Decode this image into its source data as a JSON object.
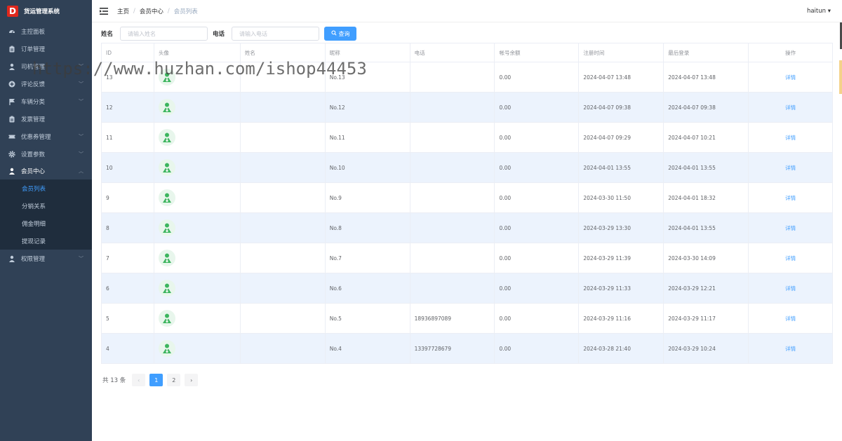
{
  "brand": {
    "logo_letter": "D",
    "title": "货运管理系统"
  },
  "sidebar": {
    "items": [
      {
        "label": "主控面板",
        "icon": "dashboard-icon",
        "arrow": false
      },
      {
        "label": "订单管理",
        "icon": "clipboard-icon",
        "arrow": false
      },
      {
        "label": "司机管理",
        "icon": "user-icon",
        "arrow": true
      },
      {
        "label": "评论反馈",
        "icon": "plus-circle-icon",
        "arrow": true
      },
      {
        "label": "车辆分类",
        "icon": "flag-icon",
        "arrow": true
      },
      {
        "label": "发票管理",
        "icon": "clipboard-icon",
        "arrow": false
      },
      {
        "label": "优惠券管理",
        "icon": "ticket-icon",
        "arrow": true
      },
      {
        "label": "设置参数",
        "icon": "gear-icon",
        "arrow": true
      },
      {
        "label": "会员中心",
        "icon": "user-icon",
        "arrow": true,
        "open": true
      },
      {
        "label": "权限管理",
        "icon": "user-icon",
        "arrow": true
      }
    ],
    "submenu": [
      {
        "label": "会员列表",
        "active": true
      },
      {
        "label": "分销关系",
        "active": false
      },
      {
        "label": "佣金明细",
        "active": false
      },
      {
        "label": "提现记录",
        "active": false
      }
    ]
  },
  "header": {
    "breadcrumb": [
      "主页",
      "会员中心",
      "会员列表"
    ],
    "user": "haitun"
  },
  "filter": {
    "name_label": "姓名",
    "name_placeholder": "请输入姓名",
    "phone_label": "电话",
    "phone_placeholder": "请输入电话",
    "search_label": "查询"
  },
  "table": {
    "columns": [
      "ID",
      "头像",
      "姓名",
      "昵称",
      "电话",
      "帐号余额",
      "注册时间",
      "最后登录",
      "操作"
    ],
    "rows": [
      {
        "id": "13",
        "name": "",
        "nickname": "No.13",
        "phone": "",
        "balance": "0.00",
        "registered": "2024-04-07 13:48",
        "last_login": "2024-04-07 13:48",
        "action": "详情"
      },
      {
        "id": "12",
        "name": "",
        "nickname": "No.12",
        "phone": "",
        "balance": "0.00",
        "registered": "2024-04-07 09:38",
        "last_login": "2024-04-07 09:38",
        "action": "详情"
      },
      {
        "id": "11",
        "name": "",
        "nickname": "No.11",
        "phone": "",
        "balance": "0.00",
        "registered": "2024-04-07 09:29",
        "last_login": "2024-04-07 10:21",
        "action": "详情"
      },
      {
        "id": "10",
        "name": "",
        "nickname": "No.10",
        "phone": "",
        "balance": "0.00",
        "registered": "2024-04-01 13:55",
        "last_login": "2024-04-01 13:55",
        "action": "详情"
      },
      {
        "id": "9",
        "name": "",
        "nickname": "No.9",
        "phone": "",
        "balance": "0.00",
        "registered": "2024-03-30 11:50",
        "last_login": "2024-04-01 18:32",
        "action": "详情"
      },
      {
        "id": "8",
        "name": "",
        "nickname": "No.8",
        "phone": "",
        "balance": "0.00",
        "registered": "2024-03-29 13:30",
        "last_login": "2024-04-01 13:55",
        "action": "详情"
      },
      {
        "id": "7",
        "name": "",
        "nickname": "No.7",
        "phone": "",
        "balance": "0.00",
        "registered": "2024-03-29 11:39",
        "last_login": "2024-03-30 14:09",
        "action": "详情"
      },
      {
        "id": "6",
        "name": "",
        "nickname": "No.6",
        "phone": "",
        "balance": "0.00",
        "registered": "2024-03-29 11:33",
        "last_login": "2024-03-29 12:21",
        "action": "详情"
      },
      {
        "id": "5",
        "name": "",
        "nickname": "No.5",
        "phone": "18936897089",
        "balance": "0.00",
        "registered": "2024-03-29 11:16",
        "last_login": "2024-03-29 11:17",
        "action": "详情"
      },
      {
        "id": "4",
        "name": "",
        "nickname": "No.4",
        "phone": "13397728679",
        "balance": "0.00",
        "registered": "2024-03-28 21:40",
        "last_login": "2024-03-29 10:24",
        "action": "详情"
      }
    ]
  },
  "pagination": {
    "total_text": "共 13 条",
    "pages": [
      "1",
      "2"
    ],
    "current": "1",
    "prev": "‹",
    "next": "›"
  },
  "watermark": "https://www.huzhan.com/ishop44453",
  "colors": {
    "sidebar_bg": "#304156",
    "accent": "#409eff",
    "stripe": "#ecf3fd",
    "logo": "#e0281d",
    "avatar_green": "#3cb55e"
  }
}
